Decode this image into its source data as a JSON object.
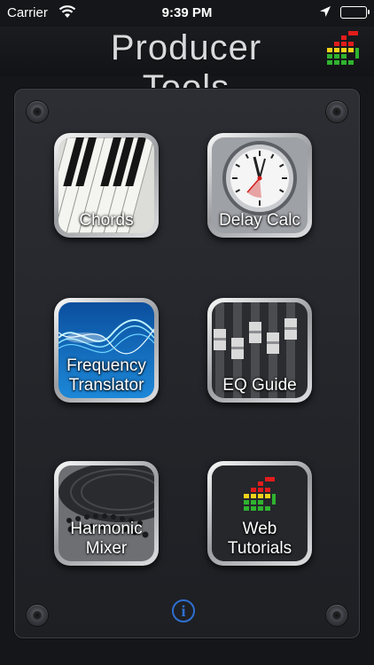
{
  "status_bar": {
    "carrier": "Carrier",
    "time": "9:39 PM",
    "icons": [
      "wifi-icon",
      "location-arrow-icon",
      "battery-icon"
    ]
  },
  "header": {
    "title": "Producer Tools",
    "logo_icon": "producer-tools-logo-icon"
  },
  "tiles": [
    {
      "label": "Chords",
      "icon": "piano-keys-icon"
    },
    {
      "label": "Delay Calc",
      "icon": "clock-icon"
    },
    {
      "label_lines": [
        "Frequency",
        "Translator"
      ],
      "icon": "sound-wave-icon"
    },
    {
      "label": "EQ Guide",
      "icon": "eq-faders-icon"
    },
    {
      "label_lines": [
        "Harmonic",
        "Mixer"
      ],
      "icon": "turntable-icon"
    },
    {
      "label_lines": [
        "Web",
        "Tutorials"
      ],
      "icon": "producer-tools-logo-icon"
    }
  ],
  "footer": {
    "info_glyph": "i",
    "info_icon": "info-icon"
  },
  "colors": {
    "background": "#151619",
    "panel": "#2a2c31",
    "info_blue": "#2f6fd0",
    "logo_red": "#e21c1c",
    "logo_yellow": "#f3d21a",
    "logo_green": "#2fb32f"
  }
}
